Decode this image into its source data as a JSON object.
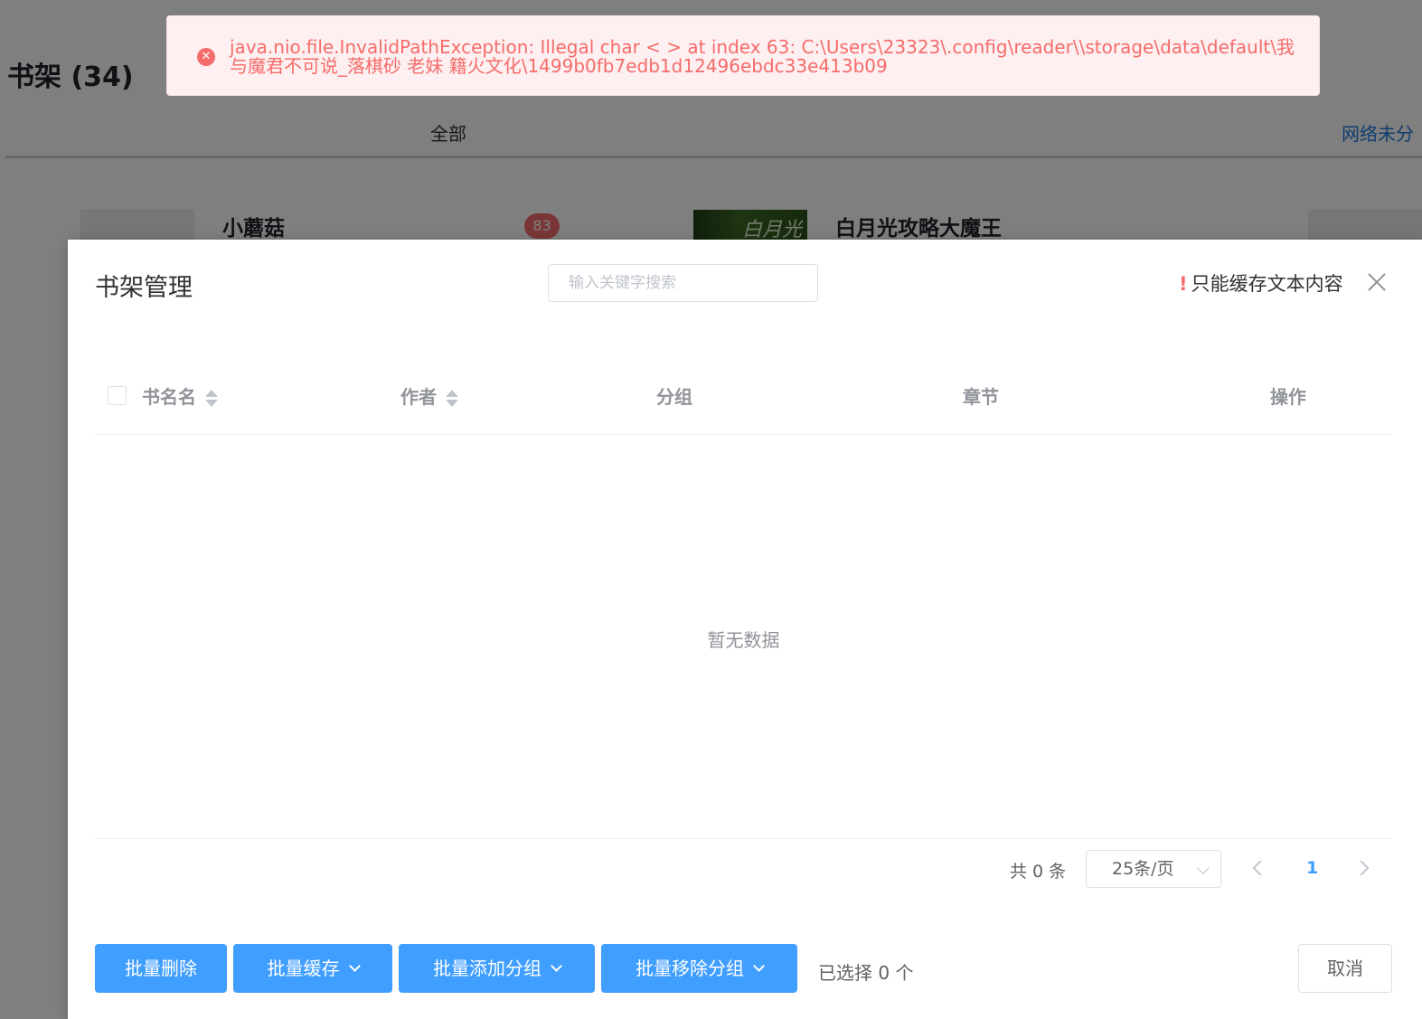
{
  "background": {
    "title": "书架 (34)",
    "tabs": {
      "all": "全部",
      "network_unsorted": "网络未分"
    },
    "books": [
      {
        "title": "小蘑菇",
        "badge": "83"
      },
      {
        "title": "白月光攻略大魔王",
        "cover_text": "白月光"
      }
    ]
  },
  "error_message": {
    "icon": "close-circle-icon",
    "text": "java.nio.file.InvalidPathException: Illegal char < > at index 63: C:\\Users\\23323\\.config\\reader\\\\storage\\data\\default\\我与魔君不可说_落棋砂 老妹 籍火文化\\1499b0fb7edb1d12496ebdc33e413b09"
  },
  "dialog": {
    "title": "书架管理",
    "search": {
      "placeholder": "输入关键字搜索",
      "value": ""
    },
    "warning": "只能缓存文本内容",
    "columns": {
      "name": "书名名",
      "author": "作者",
      "group": "分组",
      "chapter": "章节",
      "action": "操作"
    },
    "empty_text": "暂无数据",
    "pagination": {
      "total": "共 0 条",
      "page_size": "25条/页",
      "current_page": "1"
    },
    "buttons": {
      "batch_delete": "批量删除",
      "batch_cache": "批量缓存",
      "batch_add_group": "批量添加分组",
      "batch_remove_group": "批量移除分组",
      "cancel": "取消"
    },
    "selected_text": "已选择 0 个"
  },
  "colors": {
    "primary": "#409eff",
    "danger": "#f56c6c",
    "error_bg": "#fef0f0"
  }
}
